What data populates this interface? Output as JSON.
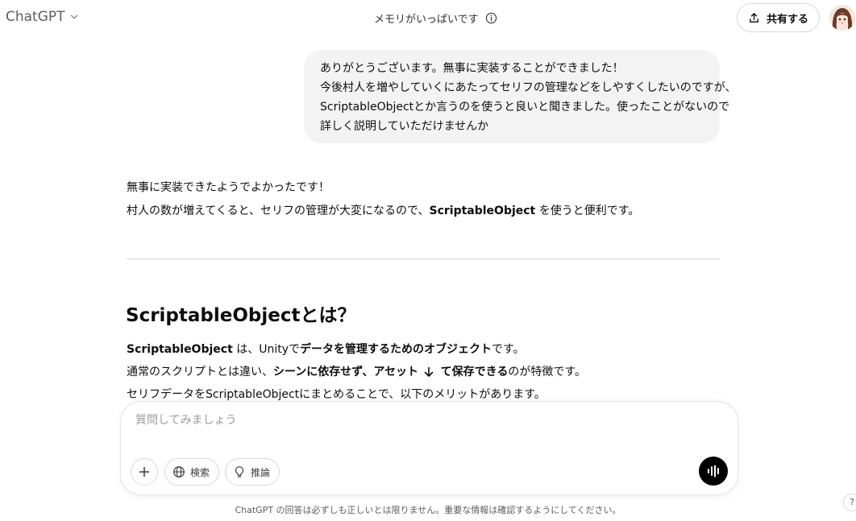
{
  "header": {
    "model_name": "ChatGPT",
    "memory_status": "メモリがいっぱいです",
    "share_label": "共有する"
  },
  "conversation": {
    "user_message_lines": [
      "ありがとうございます。無事に実装することができました！",
      "今後村人を増やしていくにあたってセリフの管理などをしやすくしたいのですが、",
      "ScriptableObjectとか言うのを使うと良いと聞きました。使ったことがないので",
      "詳しく説明していただけませんか"
    ],
    "assistant": {
      "line1": "無事に実装できたようでよかったです！",
      "line2_pre": "村人の数が増えてくると、セリフの管理が大変になるので、",
      "line2_bold": "ScriptableObject",
      "line2_post": " を使うと便利です。",
      "section_title": "ScriptableObjectとは？",
      "p1_bold1": "ScriptableObject",
      "p1_text1": " は、Unityで",
      "p1_bold2": "データを管理するためのオブジェクト",
      "p1_text2": "です。",
      "p2_text1": "通常のスクリプトとは違い、",
      "p2_bold1": "シーンに依存せず、アセットとして保存できる",
      "p2_text2": "のが特徴です。",
      "p3_text": "セリフデータをScriptableObjectにまとめることで、以下のメリットがあります。"
    }
  },
  "composer": {
    "placeholder": "質問してみましょう",
    "search_label": "検索",
    "reason_label": "推論"
  },
  "footer": {
    "disclaimer": "ChatGPT の回答は必ずしも正しいとは限りません。重要な情報は確認するようにしてください。",
    "help_label": "?"
  },
  "icons": {
    "model_chevron": "chevron-down-icon",
    "memory_info": "info-icon",
    "share": "share-icon",
    "scroll": "arrow-down-icon",
    "plus": "plus-icon",
    "search": "globe-icon",
    "reason": "lightbulb-icon",
    "voice": "voice-waveform-icon"
  },
  "colors": {
    "user_bubble_bg": "#f3f3f3",
    "voice_button_bg": "#000000",
    "divider": "#cfcfcf"
  }
}
